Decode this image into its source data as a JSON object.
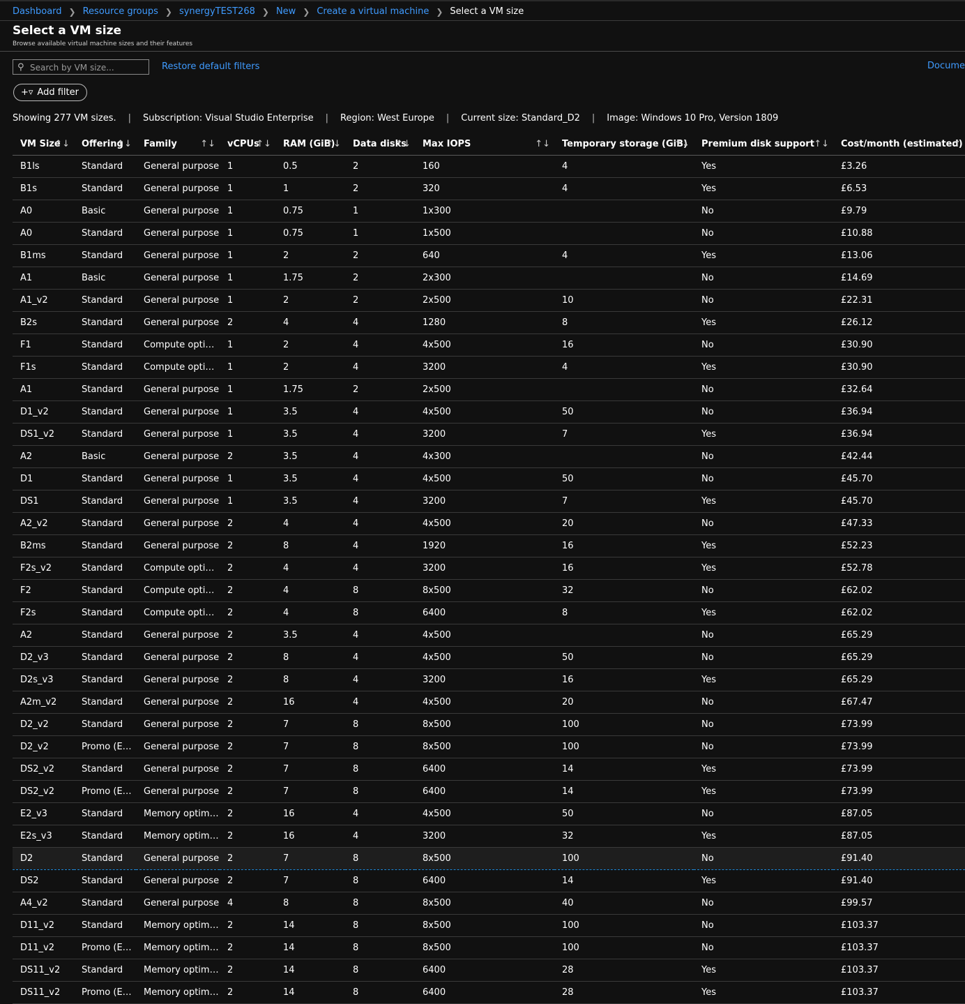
{
  "breadcrumb": {
    "items": [
      "Dashboard",
      "Resource groups",
      "synergyTEST268",
      "New",
      "Create a virtual machine"
    ],
    "current": "Select a VM size"
  },
  "page": {
    "title": "Select a VM size",
    "subtitle": "Browse available virtual machine sizes and their features"
  },
  "toolbar": {
    "search_placeholder": "Search by VM size...",
    "restore_label": "Restore default filters",
    "docs_label": "Documentation",
    "add_filter_label": "Add filter"
  },
  "summary": {
    "showing": "Showing 277 VM sizes.",
    "subscription": "Subscription: Visual Studio Enterprise",
    "region": "Region: West Europe",
    "current_size": "Current size: Standard_D2",
    "image": "Image: Windows 10 Pro, Version 1809"
  },
  "icons": {
    "search": "search-icon",
    "add_filter": "add-filter-icon",
    "sort": "sort-icon",
    "chevron": "chevron-right-icon"
  },
  "colors": {
    "background": "#111111",
    "link": "#3f9bff",
    "selection_border": "#1f88d8"
  },
  "table": {
    "columns": [
      "VM Size",
      "Offering",
      "Family",
      "vCPUs",
      "RAM (GiB)",
      "Data disks",
      "Max IOPS",
      "Temporary storage (GiB)",
      "Premium disk support",
      "Cost/month (estimated)"
    ],
    "selected_index": 31,
    "rows": [
      [
        "B1ls",
        "Standard",
        "General purpose",
        "1",
        "0.5",
        "2",
        "160",
        "4",
        "Yes",
        "£3.26"
      ],
      [
        "B1s",
        "Standard",
        "General purpose",
        "1",
        "1",
        "2",
        "320",
        "4",
        "Yes",
        "£6.53"
      ],
      [
        "A0",
        "Basic",
        "General purpose",
        "1",
        "0.75",
        "1",
        "1x300",
        "",
        "No",
        "£9.79"
      ],
      [
        "A0",
        "Standard",
        "General purpose",
        "1",
        "0.75",
        "1",
        "1x500",
        "",
        "No",
        "£10.88"
      ],
      [
        "B1ms",
        "Standard",
        "General purpose",
        "1",
        "2",
        "2",
        "640",
        "4",
        "Yes",
        "£13.06"
      ],
      [
        "A1",
        "Basic",
        "General purpose",
        "1",
        "1.75",
        "2",
        "2x300",
        "",
        "No",
        "£14.69"
      ],
      [
        "A1_v2",
        "Standard",
        "General purpose",
        "1",
        "2",
        "2",
        "2x500",
        "10",
        "No",
        "£22.31"
      ],
      [
        "B2s",
        "Standard",
        "General purpose",
        "2",
        "4",
        "4",
        "1280",
        "8",
        "Yes",
        "£26.12"
      ],
      [
        "F1",
        "Standard",
        "Compute optimized",
        "1",
        "2",
        "4",
        "4x500",
        "16",
        "No",
        "£30.90"
      ],
      [
        "F1s",
        "Standard",
        "Compute optimized",
        "1",
        "2",
        "4",
        "3200",
        "4",
        "Yes",
        "£30.90"
      ],
      [
        "A1",
        "Standard",
        "General purpose",
        "1",
        "1.75",
        "2",
        "2x500",
        "",
        "No",
        "£32.64"
      ],
      [
        "D1_v2",
        "Standard",
        "General purpose",
        "1",
        "3.5",
        "4",
        "4x500",
        "50",
        "No",
        "£36.94"
      ],
      [
        "DS1_v2",
        "Standard",
        "General purpose",
        "1",
        "3.5",
        "4",
        "3200",
        "7",
        "Yes",
        "£36.94"
      ],
      [
        "A2",
        "Basic",
        "General purpose",
        "2",
        "3.5",
        "4",
        "4x300",
        "",
        "No",
        "£42.44"
      ],
      [
        "D1",
        "Standard",
        "General purpose",
        "1",
        "3.5",
        "4",
        "4x500",
        "50",
        "No",
        "£45.70"
      ],
      [
        "DS1",
        "Standard",
        "General purpose",
        "1",
        "3.5",
        "4",
        "3200",
        "7",
        "Yes",
        "£45.70"
      ],
      [
        "A2_v2",
        "Standard",
        "General purpose",
        "2",
        "4",
        "4",
        "4x500",
        "20",
        "No",
        "£47.33"
      ],
      [
        "B2ms",
        "Standard",
        "General purpose",
        "2",
        "8",
        "4",
        "1920",
        "16",
        "Yes",
        "£52.23"
      ],
      [
        "F2s_v2",
        "Standard",
        "Compute optimized",
        "2",
        "4",
        "4",
        "3200",
        "16",
        "Yes",
        "£52.78"
      ],
      [
        "F2",
        "Standard",
        "Compute optimized",
        "2",
        "4",
        "8",
        "8x500",
        "32",
        "No",
        "£62.02"
      ],
      [
        "F2s",
        "Standard",
        "Compute optimized",
        "2",
        "4",
        "8",
        "6400",
        "8",
        "Yes",
        "£62.02"
      ],
      [
        "A2",
        "Standard",
        "General purpose",
        "2",
        "3.5",
        "4",
        "4x500",
        "",
        "No",
        "£65.29"
      ],
      [
        "D2_v3",
        "Standard",
        "General purpose",
        "2",
        "8",
        "4",
        "4x500",
        "50",
        "No",
        "£65.29"
      ],
      [
        "D2s_v3",
        "Standard",
        "General purpose",
        "2",
        "8",
        "4",
        "3200",
        "16",
        "Yes",
        "£65.29"
      ],
      [
        "A2m_v2",
        "Standard",
        "General purpose",
        "2",
        "16",
        "4",
        "4x500",
        "20",
        "No",
        "£67.47"
      ],
      [
        "D2_v2",
        "Standard",
        "General purpose",
        "2",
        "7",
        "8",
        "8x500",
        "100",
        "No",
        "£73.99"
      ],
      [
        "D2_v2",
        "Promo (Expires)",
        "General purpose",
        "2",
        "7",
        "8",
        "8x500",
        "100",
        "No",
        "£73.99"
      ],
      [
        "DS2_v2",
        "Standard",
        "General purpose",
        "2",
        "7",
        "8",
        "6400",
        "14",
        "Yes",
        "£73.99"
      ],
      [
        "DS2_v2",
        "Promo (Expires)",
        "General purpose",
        "2",
        "7",
        "8",
        "6400",
        "14",
        "Yes",
        "£73.99"
      ],
      [
        "E2_v3",
        "Standard",
        "Memory optimized",
        "2",
        "16",
        "4",
        "4x500",
        "50",
        "No",
        "£87.05"
      ],
      [
        "E2s_v3",
        "Standard",
        "Memory optimized",
        "2",
        "16",
        "4",
        "3200",
        "32",
        "Yes",
        "£87.05"
      ],
      [
        "D2",
        "Standard",
        "General purpose",
        "2",
        "7",
        "8",
        "8x500",
        "100",
        "No",
        "£91.40"
      ],
      [
        "DS2",
        "Standard",
        "General purpose",
        "2",
        "7",
        "8",
        "6400",
        "14",
        "Yes",
        "£91.40"
      ],
      [
        "A4_v2",
        "Standard",
        "General purpose",
        "4",
        "8",
        "8",
        "8x500",
        "40",
        "No",
        "£99.57"
      ],
      [
        "D11_v2",
        "Standard",
        "Memory optimized",
        "2",
        "14",
        "8",
        "8x500",
        "100",
        "No",
        "£103.37"
      ],
      [
        "D11_v2",
        "Promo (Expires)",
        "Memory optimized",
        "2",
        "14",
        "8",
        "8x500",
        "100",
        "No",
        "£103.37"
      ],
      [
        "DS11_v2",
        "Standard",
        "Memory optimized",
        "2",
        "14",
        "8",
        "6400",
        "28",
        "Yes",
        "£103.37"
      ],
      [
        "DS11_v2",
        "Promo (Expires)",
        "Memory optimized",
        "2",
        "14",
        "8",
        "6400",
        "28",
        "Yes",
        "£103.37"
      ]
    ]
  }
}
